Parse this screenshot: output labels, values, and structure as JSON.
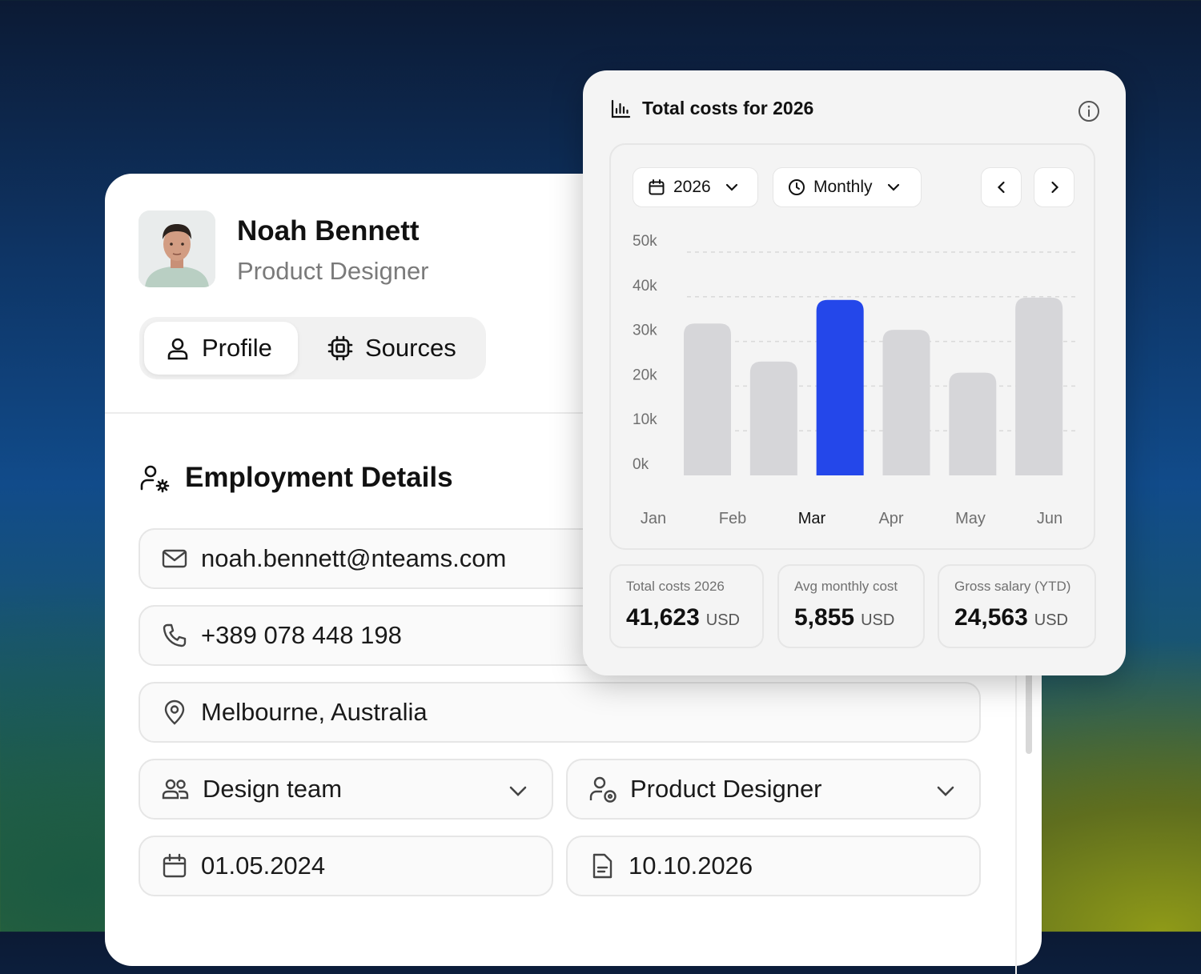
{
  "profile": {
    "name": "Noah Bennett",
    "role": "Product Designer",
    "tabs": [
      {
        "label": "Profile",
        "icon": "user-icon",
        "active": true
      },
      {
        "label": "Sources",
        "icon": "chip-icon",
        "active": false
      }
    ]
  },
  "employment": {
    "title": "Employment Details",
    "email": "noah.bennett@nteams.com",
    "phone": "+389 078 448 198",
    "location": "Melbourne, Australia",
    "team": "Design team",
    "position": "Product Designer",
    "start_date": "01.05.2024",
    "end_date": "10.10.2026"
  },
  "costs": {
    "title": "Total costs for 2026",
    "year_select": "2026",
    "period_select": "Monthly",
    "stats": [
      {
        "label": "Total costs 2026",
        "value": "41,623",
        "unit": "USD"
      },
      {
        "label": "Avg monthly cost",
        "value": "5,855",
        "unit": "USD"
      },
      {
        "label": "Gross salary (YTD)",
        "value": "24,563",
        "unit": "USD"
      }
    ]
  },
  "colors": {
    "accent": "#2447ea",
    "bar_default": "#d6d6d9"
  },
  "chart_data": {
    "type": "bar",
    "categories": [
      "Jan",
      "Feb",
      "Mar",
      "Apr",
      "May",
      "Jun"
    ],
    "values": [
      34000,
      25500,
      39300,
      32600,
      23000,
      39800
    ],
    "highlighted": "Mar",
    "ylim": [
      0,
      50000
    ],
    "yticks": [
      "0k",
      "10k",
      "20k",
      "30k",
      "40k",
      "50k"
    ],
    "grid": true
  }
}
